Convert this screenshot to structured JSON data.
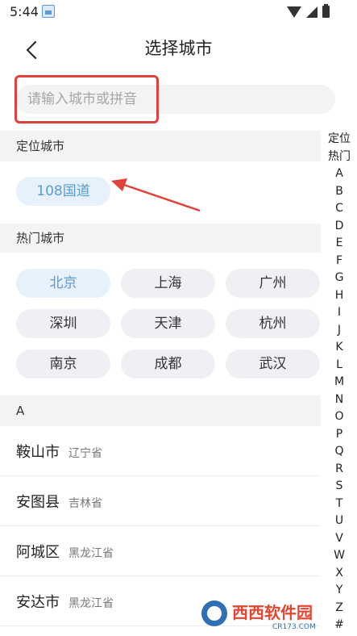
{
  "status_bar": {
    "time": "5:44"
  },
  "header": {
    "title": "选择城市"
  },
  "search": {
    "placeholder": "请输入城市或拼音"
  },
  "sections": {
    "location": {
      "header": "定位城市",
      "city": "108国道"
    },
    "hot": {
      "header": "热门城市",
      "cities": [
        "北京",
        "上海",
        "广州",
        "深圳",
        "天津",
        "杭州",
        "南京",
        "成都",
        "武汉"
      ]
    },
    "a": {
      "header": "A",
      "cities": [
        {
          "name": "鞍山市",
          "province": "辽宁省"
        },
        {
          "name": "安图县",
          "province": "吉林省"
        },
        {
          "name": "阿城区",
          "province": "黑龙江省"
        },
        {
          "name": "安达市",
          "province": "黑龙江省"
        }
      ]
    }
  },
  "index": [
    "定位",
    "热门",
    "A",
    "B",
    "C",
    "D",
    "E",
    "F",
    "G",
    "H",
    "I",
    "J",
    "K",
    "L",
    "M",
    "N",
    "O",
    "P",
    "Q",
    "R",
    "S",
    "T",
    "U",
    "V",
    "W",
    "X",
    "Y",
    "Z",
    "#"
  ],
  "colors": {
    "accent": "#5b9bd5",
    "highlight": "#e0413a",
    "section_bg": "#f3f4f6",
    "chip_bg": "#eef0f3"
  },
  "watermark": {
    "brand": "西西软件园",
    "domain": "CR173.COM"
  }
}
